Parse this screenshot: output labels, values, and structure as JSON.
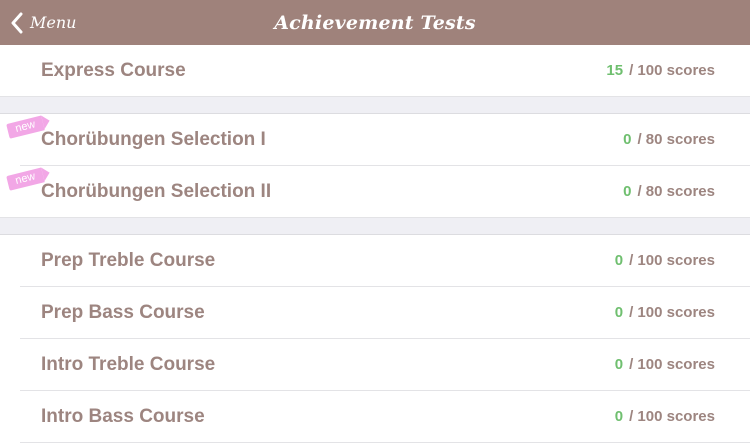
{
  "nav": {
    "back_label": "Menu",
    "title": "Achievement Tests"
  },
  "sections": [
    {
      "rows": [
        {
          "label": "Express Course",
          "score": "15",
          "max": "/ 100 scores",
          "new": false
        }
      ]
    },
    {
      "rows": [
        {
          "label": "Chorübungen Selection I",
          "score": "0",
          "max": "/ 80 scores",
          "new": true,
          "badge": "new"
        },
        {
          "label": "Chorübungen Selection II",
          "score": "0",
          "max": "/ 80 scores",
          "new": true,
          "badge": "new"
        }
      ]
    },
    {
      "rows": [
        {
          "label": "Prep Treble Course",
          "score": "0",
          "max": "/ 100 scores",
          "new": false
        },
        {
          "label": "Prep Bass Course",
          "score": "0",
          "max": "/ 100 scores",
          "new": false
        },
        {
          "label": "Intro Treble Course",
          "score": "0",
          "max": "/ 100 scores",
          "new": false
        },
        {
          "label": "Intro Bass Course",
          "score": "0",
          "max": "/ 100 scores",
          "new": false
        }
      ]
    }
  ],
  "colors": {
    "navbar": "#9f827b",
    "label": "#9d8580",
    "score": "#6fbf6f",
    "new_badge": "#f2a7e6"
  }
}
